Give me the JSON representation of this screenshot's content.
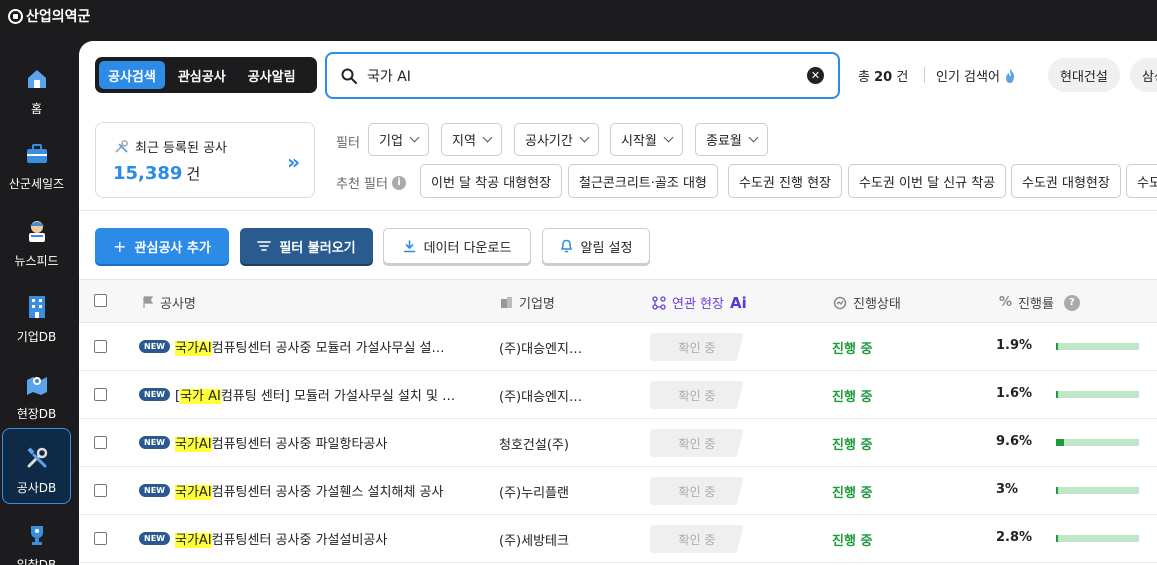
{
  "app": {
    "name": "산업의역군"
  },
  "sidebar": {
    "items": [
      {
        "label": "홈",
        "icon": "home-icon",
        "active": false
      },
      {
        "label": "산군세일즈",
        "icon": "briefcase-icon",
        "active": false
      },
      {
        "label": "뉴스피드",
        "icon": "news-icon",
        "active": false
      },
      {
        "label": "기업DB",
        "icon": "building-icon",
        "active": false
      },
      {
        "label": "현장DB",
        "icon": "site-map-icon",
        "active": false
      },
      {
        "label": "공사DB",
        "icon": "tools-icon",
        "active": true
      },
      {
        "label": "입찰DB",
        "icon": "trophy-icon",
        "active": false
      }
    ]
  },
  "tabs": [
    {
      "label": "공사검색",
      "active": true
    },
    {
      "label": "관심공사",
      "active": false
    },
    {
      "label": "공사알림",
      "active": false
    }
  ],
  "search": {
    "value": "국가 AI"
  },
  "results": {
    "total_prefix": "총",
    "total_count": "20",
    "total_suffix": "건"
  },
  "popular": {
    "label": "인기 검색어",
    "chips": [
      "현대건설",
      "삼성"
    ]
  },
  "recent": {
    "title": "최근 등록된 공사",
    "count": "15,389",
    "unit": "건"
  },
  "filters": {
    "label": "필터",
    "dropdowns": [
      "기업",
      "지역",
      "공사기간",
      "시작월",
      "종료월"
    ],
    "recommended_label": "추천 필터",
    "recommended": [
      "이번 달 착공 대형현장",
      "철근콘크리트·골조 대형",
      "수도권 진행 현장",
      "수도권 이번 달 신규 착공",
      "수도권 대형현장",
      "수도권"
    ]
  },
  "actions": {
    "add_interest": "관심공사 추가",
    "load_filter": "필터 불러오기",
    "download": "데이터 다운로드",
    "alert_settings": "알림 설정"
  },
  "table": {
    "headers": {
      "name": "공사명",
      "company": "기업명",
      "related_prefix": "연관 현장",
      "related_ai": "Ai",
      "status": "진행상태",
      "progress": "진행률"
    },
    "rows": [
      {
        "badge": "NEW",
        "pre": "",
        "highlight": "국가AI",
        "post": "컴퓨팅센터 공사중 모듈러 가설사무실 설…",
        "company": "(주)대승엔지…",
        "related": "확인 중",
        "status": "진행 중",
        "progress_text": "1.9%",
        "progress": 1.9
      },
      {
        "badge": "NEW",
        "pre": "[",
        "highlight": "국가 AI",
        "post": "컴퓨팅 센터] 모듈러 가설사무실 설치 및 …",
        "company": "(주)대승엔지…",
        "related": "확인 중",
        "status": "진행 중",
        "progress_text": "1.6%",
        "progress": 1.6
      },
      {
        "badge": "NEW",
        "pre": "",
        "highlight": "국가AI",
        "post": "컴퓨팅센터 공사중 파일항타공사",
        "company": "청호건설(주)",
        "related": "확인 중",
        "status": "진행 중",
        "progress_text": "9.6%",
        "progress": 9.6
      },
      {
        "badge": "NEW",
        "pre": "",
        "highlight": "국가AI",
        "post": "컴퓨팅센터 공사중 가설휀스 설치해체 공사",
        "company": "(주)누리플랜",
        "related": "확인 중",
        "status": "진행 중",
        "progress_text": "3%",
        "progress": 3
      },
      {
        "badge": "NEW",
        "pre": "",
        "highlight": "국가AI",
        "post": "컴퓨팅센터 공사중 가설설비공사",
        "company": "(주)세방테크",
        "related": "확인 중",
        "status": "진행 중",
        "progress_text": "2.8%",
        "progress": 2.8
      }
    ]
  },
  "colors": {
    "accent": "#2b8be6",
    "dark": "#1c1c1e",
    "status_green": "#1f9a3a",
    "highlight": "#ffff3c"
  }
}
